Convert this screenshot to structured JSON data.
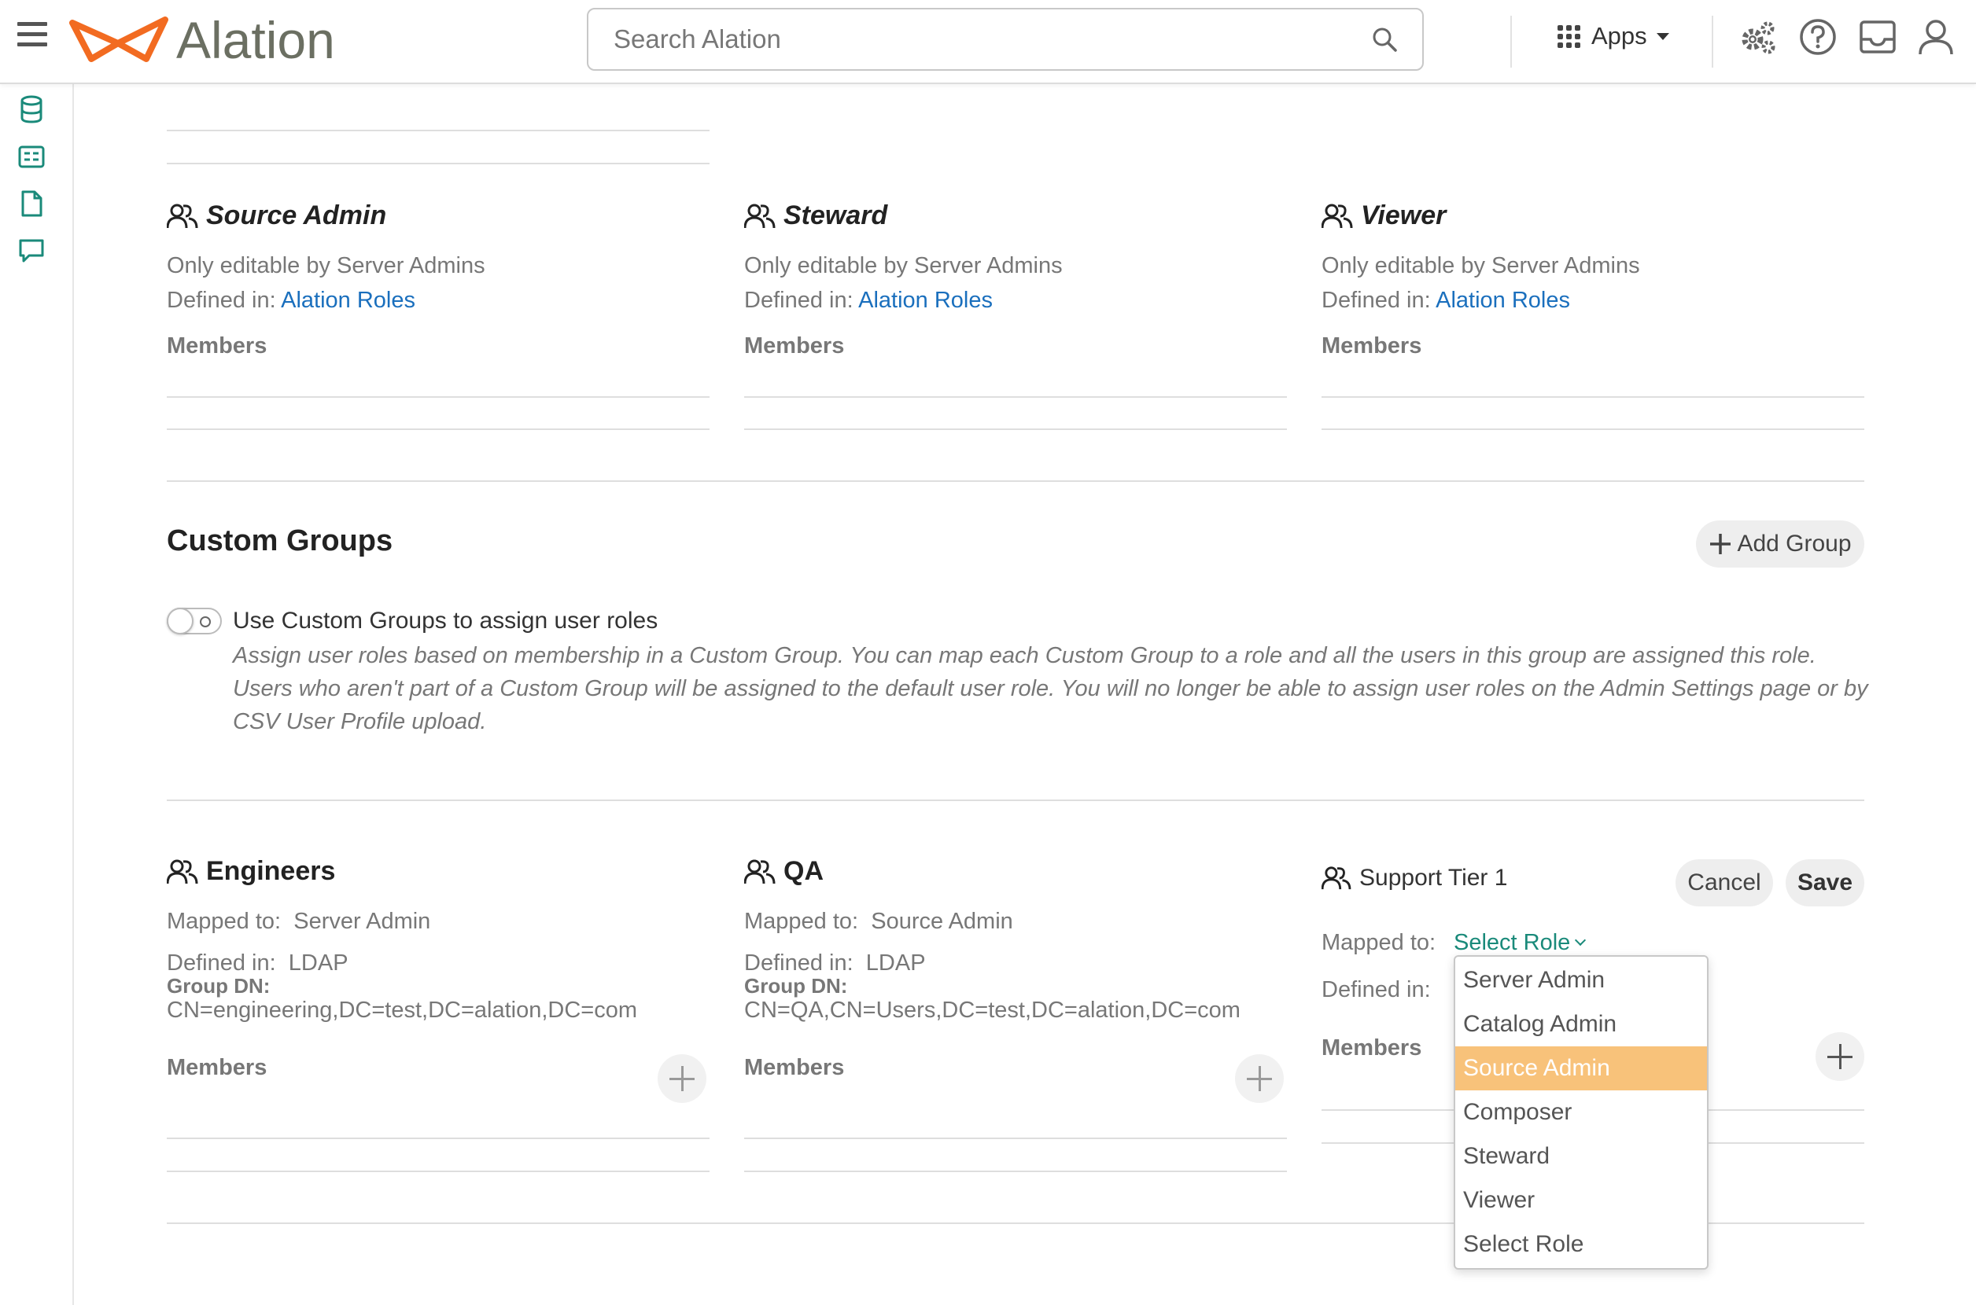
{
  "topbar": {
    "brand": "Alation",
    "search_placeholder": "Search Alation",
    "apps_label": "Apps"
  },
  "roles": [
    {
      "title": "Source Admin",
      "editable_note": "Only editable by Server Admins",
      "defined_label": "Defined in:",
      "defined_value": "Alation Roles",
      "members_label": "Members"
    },
    {
      "title": "Steward",
      "editable_note": "Only editable by Server Admins",
      "defined_label": "Defined in:",
      "defined_value": "Alation Roles",
      "members_label": "Members"
    },
    {
      "title": "Viewer",
      "editable_note": "Only editable by Server Admins",
      "defined_label": "Defined in:",
      "defined_value": "Alation Roles",
      "members_label": "Members"
    }
  ],
  "custom_groups": {
    "title": "Custom Groups",
    "add_group_label": "Add Group",
    "toggle_label": "Use Custom Groups to assign user roles",
    "toggle_on": false,
    "description": "Assign user roles based on membership in a Custom Group. You can map each Custom Group to a role and all the users in this group are assigned this role. Users who aren't part of a Custom Group will be assigned to the default user role. You will no longer be able to assign user roles on the Admin Settings page or by CSV User Profile upload.",
    "groups": [
      {
        "name": "Engineers",
        "mapped_label": "Mapped to:",
        "mapped_value": "Server Admin",
        "defined_label": "Defined in:",
        "defined_value": "LDAP",
        "dn_label": "Group DN:",
        "dn_value": "CN=engineering,DC=test,DC=alation,DC=com",
        "members_label": "Members"
      },
      {
        "name": "QA",
        "mapped_label": "Mapped to:",
        "mapped_value": "Source Admin",
        "defined_label": "Defined in:",
        "defined_value": "LDAP",
        "dn_label": "Group DN:",
        "dn_value": "CN=QA,CN=Users,DC=test,DC=alation,DC=com",
        "members_label": "Members"
      }
    ],
    "editing": {
      "name": "Support Tier 1",
      "cancel_label": "Cancel",
      "save_label": "Save",
      "mapped_label": "Mapped to:",
      "select_label": "Select Role",
      "defined_label": "Defined in:",
      "members_label": "Members",
      "dropdown_options": [
        "Server Admin",
        "Catalog Admin",
        "Source Admin",
        "Composer",
        "Steward",
        "Viewer",
        "Select Role"
      ],
      "highlighted_option": "Source Admin"
    }
  },
  "colors": {
    "brand_orange": "#f26b21",
    "link_blue": "#1a6fbd",
    "teal": "#1a8a7a",
    "highlight": "#f8c27a"
  }
}
